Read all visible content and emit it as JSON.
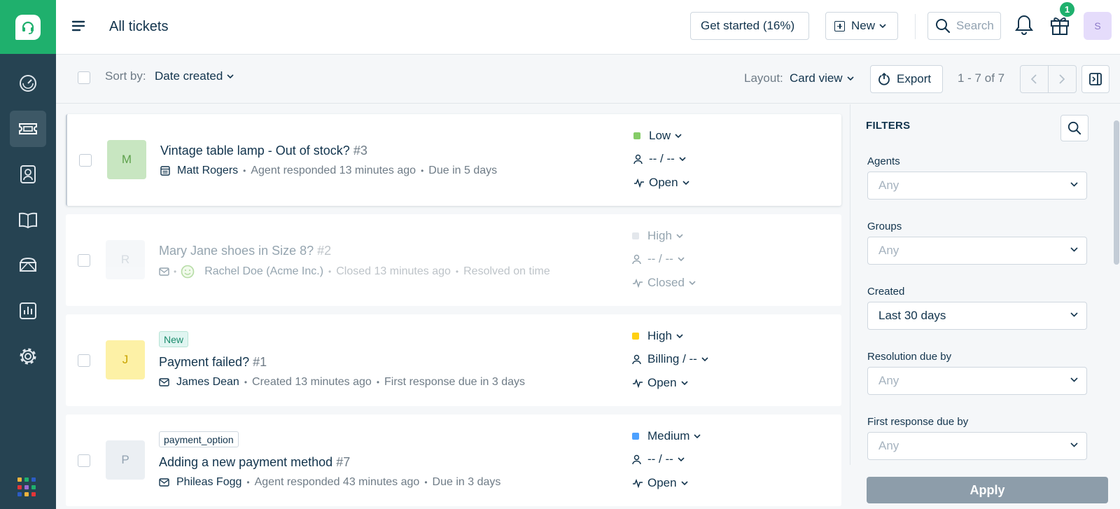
{
  "sidebar": {
    "nav": [
      "dashboard-icon",
      "tickets-icon",
      "contacts-icon",
      "solutions-icon",
      "forums-icon",
      "reports-icon",
      "settings-icon"
    ],
    "apps_colors": [
      "#f3b33d",
      "#1fb06d",
      "#2c5cc5",
      "#e43538",
      "#9b6bd3",
      "#1fb06d",
      "#2c5cc5",
      "#f3b33d",
      "#e43538"
    ]
  },
  "header": {
    "title": "All tickets",
    "get_started": "Get started (16%)",
    "new_label": "New",
    "search_placeholder": "Search",
    "gift_badge": "1",
    "avatar_initial": "S"
  },
  "toolbar": {
    "sort_label": "Sort by:",
    "sort_value": "Date created",
    "layout_label": "Layout:",
    "layout_value": "Card view",
    "export_label": "Export",
    "pagination": "1 - 7 of 7"
  },
  "tickets": [
    {
      "initial": "M",
      "avatar_bg": "#c8e6c1",
      "avatar_fg": "#5ea14c",
      "tag": "",
      "title": "Vintage table lamp - Out of stock?",
      "number": "#3",
      "contact": "Matt Rogers",
      "activity": "Agent responded 13 minutes ago",
      "due": "Due in 5 days",
      "priority": "Low",
      "priority_color": "#85cc67",
      "assignee": "-- / --",
      "status": "Open"
    },
    {
      "initial": "R",
      "avatar_bg": "#ebeff3",
      "avatar_fg": "#a6b3bf",
      "tag": "",
      "title": "Mary Jane shoes in Size 8?",
      "number": "#2",
      "contact": "Rachel Doe (Acme Inc.)",
      "activity": "Closed 13 minutes ago",
      "due": "Resolved on time",
      "priority": "High",
      "priority_color": "#c3ccd6",
      "assignee": "-- / --",
      "status": "Closed"
    },
    {
      "initial": "J",
      "avatar_bg": "#fdf1a6",
      "avatar_fg": "#c9a300",
      "tag": "New",
      "title": "Payment failed?",
      "number": "#1",
      "contact": "James Dean",
      "activity": "Created 13 minutes ago",
      "due": "First response due in 3 days",
      "priority": "High",
      "priority_color": "#ffd012",
      "assignee": "Billing / --",
      "status": "Open"
    },
    {
      "initial": "P",
      "avatar_bg": "#ebeff3",
      "avatar_fg": "#92a2b1",
      "tag": "payment_option",
      "title": "Adding a new payment method",
      "number": "#7",
      "contact": "Phileas Fogg",
      "activity": "Agent responded 43 minutes ago",
      "due": "Due in 3 days",
      "priority": "Medium",
      "priority_color": "#4da1ff",
      "assignee": "-- / --",
      "status": "Open"
    }
  ],
  "filters": {
    "title": "FILTERS",
    "agents_label": "Agents",
    "agents_value": "Any",
    "groups_label": "Groups",
    "groups_value": "Any",
    "created_label": "Created",
    "created_value": "Last 30 days",
    "resolution_label": "Resolution due by",
    "resolution_value": "Any",
    "first_response_label": "First response due by",
    "first_response_value": "Any",
    "apply_label": "Apply"
  }
}
